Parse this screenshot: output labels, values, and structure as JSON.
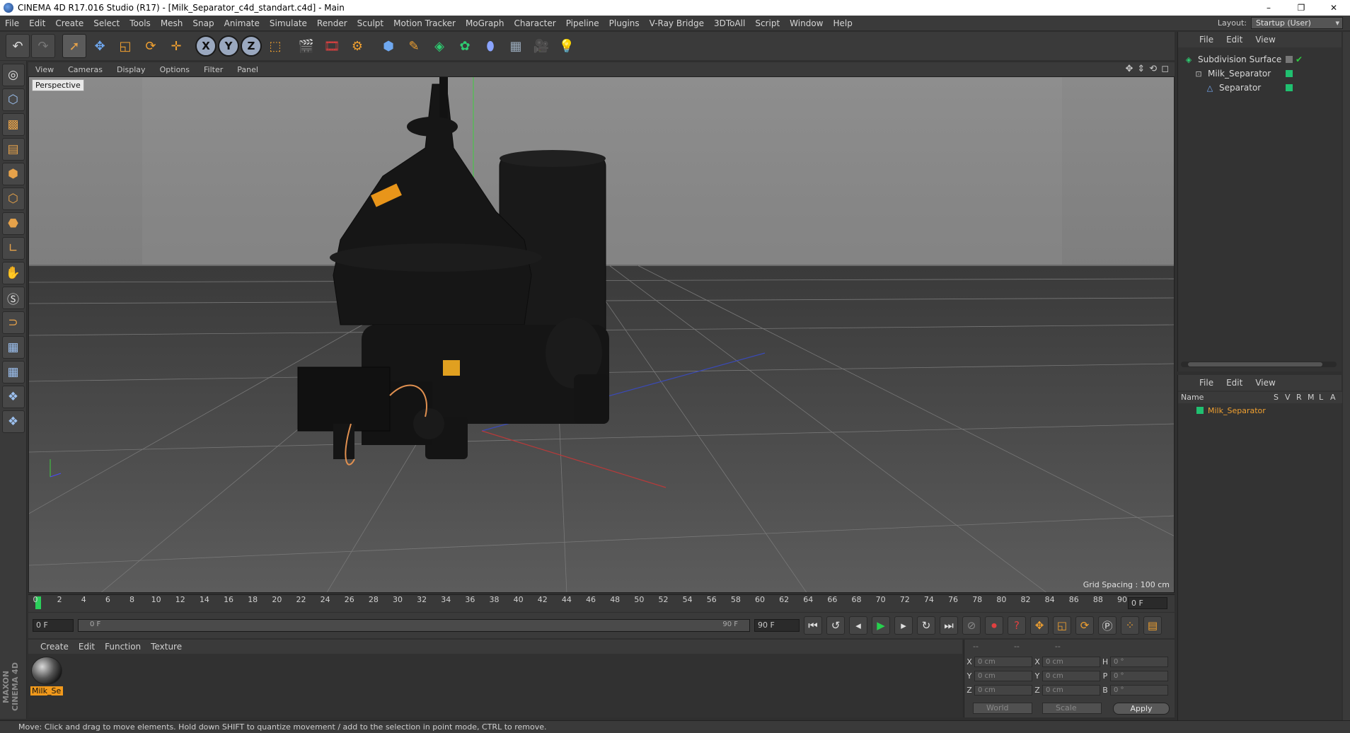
{
  "window": {
    "title": "CINEMA 4D R17.016 Studio (R17) - [Milk_Separator_c4d_standart.c4d] - Main",
    "controls": [
      "–",
      "❐",
      "✕"
    ]
  },
  "menubar": {
    "items": [
      "File",
      "Edit",
      "Create",
      "Select",
      "Tools",
      "Mesh",
      "Snap",
      "Animate",
      "Simulate",
      "Render",
      "Sculpt",
      "Motion Tracker",
      "MoGraph",
      "Character",
      "Pipeline",
      "Plugins",
      "V-Ray Bridge",
      "3DToAll",
      "Script",
      "Window",
      "Help"
    ],
    "layout_label": "Layout:",
    "layout_value": "Startup (User)"
  },
  "viewport": {
    "menu": [
      "View",
      "Cameras",
      "Display",
      "Options",
      "Filter",
      "Panel"
    ],
    "camera_label": "Perspective",
    "grid_spacing": "Grid Spacing : 100 cm",
    "axis_y": "y",
    "axis_z": "z"
  },
  "timeline": {
    "ticks": [
      "0",
      "2",
      "4",
      "6",
      "8",
      "10",
      "12",
      "14",
      "16",
      "18",
      "20",
      "22",
      "24",
      "26",
      "28",
      "30",
      "32",
      "34",
      "36",
      "38",
      "40",
      "42",
      "44",
      "46",
      "48",
      "50",
      "52",
      "54",
      "56",
      "58",
      "60",
      "62",
      "64",
      "66",
      "68",
      "70",
      "72",
      "74",
      "76",
      "78",
      "80",
      "82",
      "84",
      "86",
      "88",
      "90"
    ],
    "current_frame": "0 F",
    "start_field": "0 F",
    "range_start": "0 F",
    "range_end": "90 F",
    "end_field": "90 F"
  },
  "material_manager": {
    "menu": [
      "Create",
      "Edit",
      "Function",
      "Texture"
    ],
    "materials": [
      {
        "name": "Milk_Se"
      }
    ]
  },
  "coordinates": {
    "headers": [
      "--",
      "--",
      "--"
    ],
    "rows": [
      {
        "a": "X",
        "av": "0 cm",
        "b": "X",
        "bv": "0 cm",
        "c": "H",
        "cv": "0 °"
      },
      {
        "a": "Y",
        "av": "0 cm",
        "b": "Y",
        "bv": "0 cm",
        "c": "P",
        "cv": "0 °"
      },
      {
        "a": "Z",
        "av": "0 cm",
        "b": "Z",
        "bv": "0 cm",
        "c": "B",
        "cv": "0 °"
      }
    ],
    "space_select": "World",
    "mode_select": "Scale",
    "apply_label": "Apply"
  },
  "object_manager": {
    "menu": [
      "File",
      "Edit",
      "View"
    ],
    "objects": [
      {
        "name": "Subdivision Surface"
      },
      {
        "name": "Milk_Separator"
      },
      {
        "name": "Separator"
      }
    ]
  },
  "layer_manager": {
    "menu": [
      "File",
      "Edit",
      "View"
    ],
    "columns": {
      "name": "Name",
      "s": "S",
      "v": "V",
      "r": "R",
      "m": "M",
      "l": "L",
      "a": "A"
    },
    "rows": [
      {
        "name": "Milk_Separator"
      }
    ]
  },
  "branding": {
    "logo": "MAXON CINEMA 4D"
  },
  "status": {
    "text": "Move: Click and drag to move elements. Hold down SHIFT to quantize movement / add to the selection in point mode, CTRL to remove."
  },
  "colors": {
    "accent_orange": "#f29a1c",
    "play_green": "#27d04e",
    "record_red": "#e04040",
    "tag_green": "#20c070"
  }
}
